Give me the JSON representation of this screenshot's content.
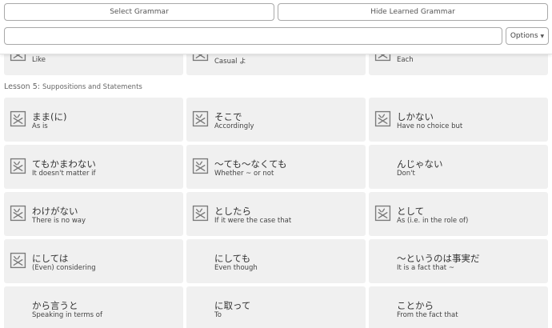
{
  "toolbar": {
    "select_label": "Select Grammar",
    "hide_label": "Hide Learned Grammar",
    "search_value": "",
    "options_label": "Options"
  },
  "prev_row": [
    {
      "en": "Like",
      "jp": "",
      "icon": true
    },
    {
      "en": "Casual よ",
      "jp": "",
      "icon": true
    },
    {
      "en": "Each",
      "jp": "",
      "icon": true
    }
  ],
  "lesson": {
    "number": "Lesson 5:",
    "title": "Suppositions and Statements"
  },
  "cards": [
    {
      "jp": "まま(に)",
      "en": "As is",
      "icon": true
    },
    {
      "jp": "そこで",
      "en": "Accordingly",
      "icon": true
    },
    {
      "jp": "しかない",
      "en": "Have no choice but",
      "icon": true
    },
    {
      "jp": "てもかまわない",
      "en": "It doesn't matter if",
      "icon": true
    },
    {
      "jp": "〜ても〜なくても",
      "en": "Whether ~ or not",
      "icon": true
    },
    {
      "jp": "んじゃない",
      "en": "Don't",
      "icon": false
    },
    {
      "jp": "わけがない",
      "en": "There is no way",
      "icon": true
    },
    {
      "jp": "としたら",
      "en": "If it were the case that",
      "icon": true
    },
    {
      "jp": "として",
      "en": "As (i.e. in the role of)",
      "icon": true
    },
    {
      "jp": "にしては",
      "en": "(Even) considering",
      "icon": true
    },
    {
      "jp": "にしても",
      "en": "Even though",
      "icon": false
    },
    {
      "jp": "〜というのは事実だ",
      "en": "It is a fact that ~",
      "icon": false
    },
    {
      "jp": "から言うと",
      "en": "Speaking in terms of",
      "icon": false
    },
    {
      "jp": "に取って",
      "en": "To",
      "icon": false
    },
    {
      "jp": "ことから",
      "en": "From the fact that",
      "icon": false
    }
  ],
  "icon_name": "kanji-zu-icon"
}
